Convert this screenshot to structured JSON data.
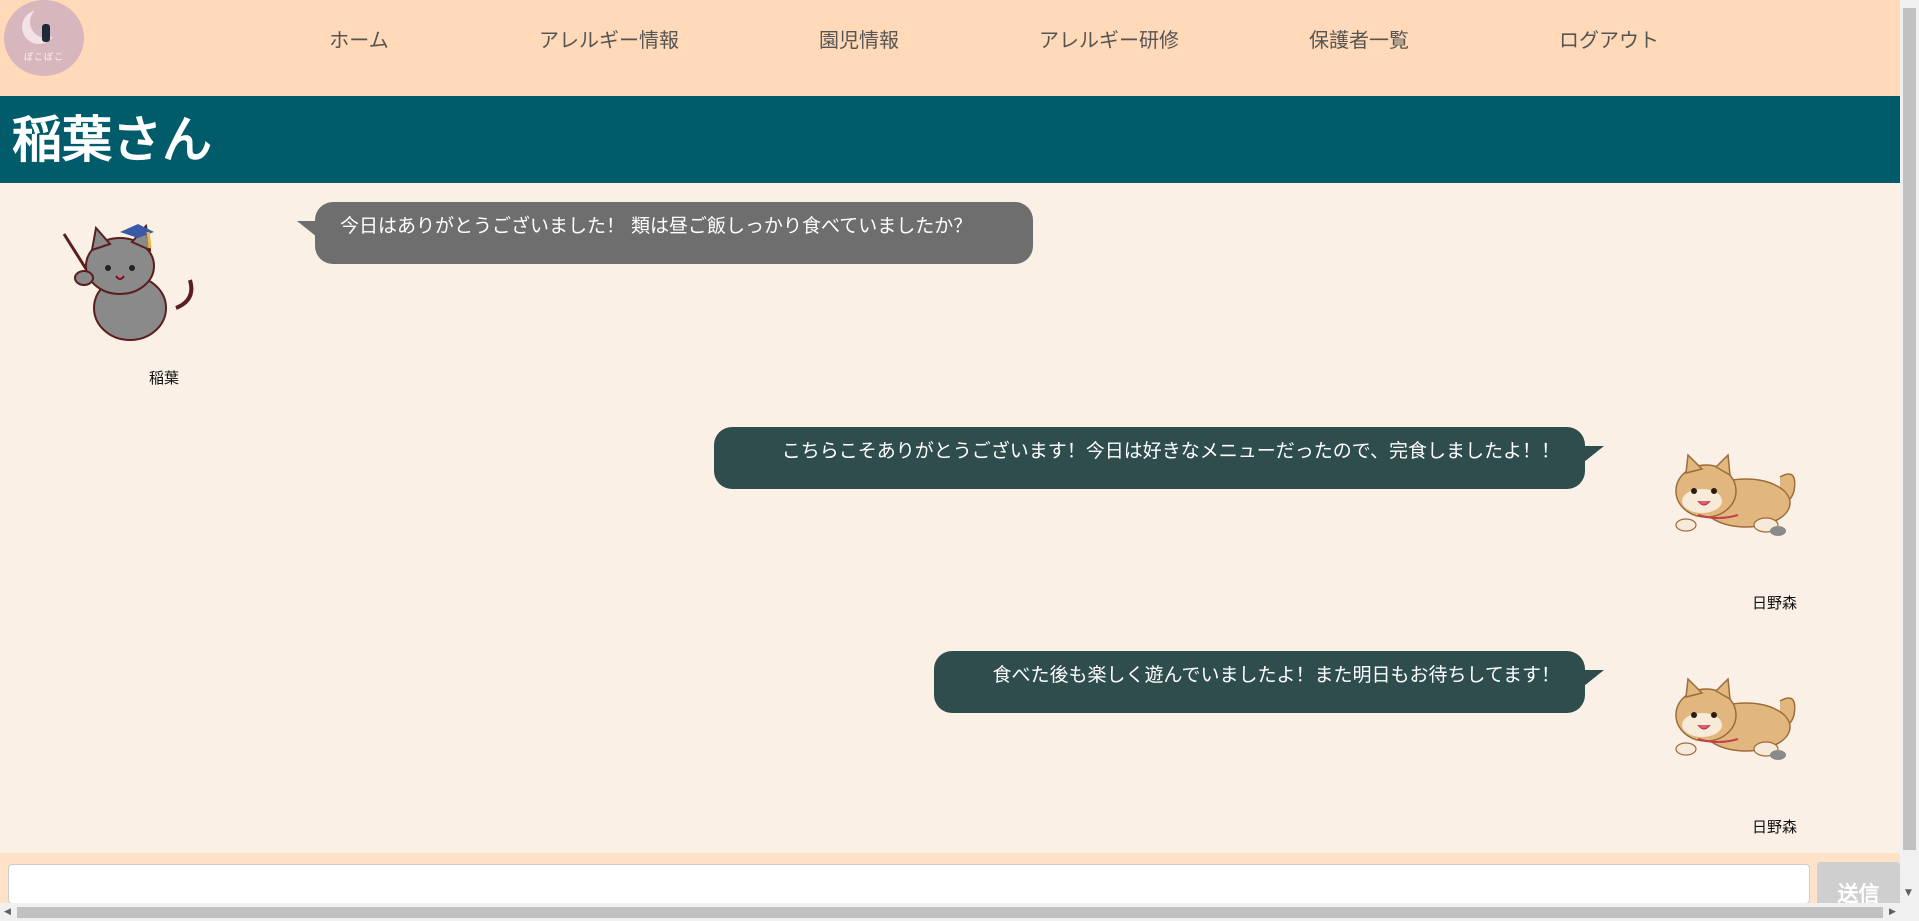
{
  "nav": {
    "logo_text": "ぽこぽこ",
    "items": [
      "ホーム",
      "アレルギー情報",
      "園児情報",
      "アレルギー研修",
      "保護者一覧",
      "ログアウト"
    ]
  },
  "header": {
    "title": "稲葉さん"
  },
  "messages": [
    {
      "text": "今日はありがとうございました！ 類は昼ご飯しっかり食べていましたか？",
      "sender": "稲葉",
      "avatar": "teacher-cat-icon"
    },
    {
      "text": "こちらこそありがとうございます！今日は好きなメニューだったので、完食しましたよ！！",
      "sender": "日野森",
      "avatar": "shiba-dog-icon"
    },
    {
      "text": "食べた後も楽しく遊んでいましたよ！また明日もお待ちしてます！",
      "sender": "日野森",
      "avatar": "shiba-dog-icon"
    }
  ],
  "composer": {
    "value": "",
    "send_label": "送信"
  },
  "colors": {
    "nav_bg": "#ffd9b8",
    "header_bg": "#005b6b",
    "page_bg": "#faf0e6",
    "bubble_left": "#6e6e6e",
    "bubble_right": "#2f4d4d"
  }
}
